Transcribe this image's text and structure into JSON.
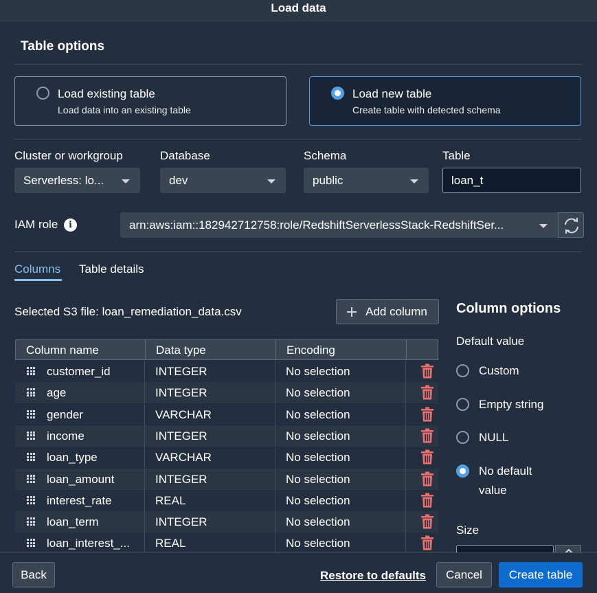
{
  "window": {
    "title": "Load data"
  },
  "table_options": {
    "title": "Table options",
    "existing": {
      "label": "Load existing table",
      "description": "Load data into an existing table",
      "selected": false
    },
    "new": {
      "label": "Load new table",
      "description": "Create table with detected schema",
      "selected": true
    }
  },
  "fields": {
    "cluster": {
      "label": "Cluster or workgroup",
      "value": "Serverless: lo..."
    },
    "database": {
      "label": "Database",
      "value": "dev"
    },
    "schema": {
      "label": "Schema",
      "value": "public"
    },
    "table": {
      "label": "Table",
      "value": "loan_t"
    }
  },
  "iam": {
    "label": "IAM role",
    "value": "arn:aws:iam::182942712758:role/RedshiftServerlessStack-RedshiftSer...",
    "info_icon": "i"
  },
  "tabs": {
    "columns": "Columns",
    "table_details": "Table details",
    "active": "columns"
  },
  "s3": {
    "label": "Selected S3 file: loan_remediation_data.csv"
  },
  "add_column": {
    "label": "Add column"
  },
  "columns_table": {
    "headers": [
      "Column name",
      "Data type",
      "Encoding"
    ],
    "rows": [
      {
        "name": "customer_id",
        "type": "INTEGER",
        "encoding": "No selection"
      },
      {
        "name": "age",
        "type": "INTEGER",
        "encoding": "No selection"
      },
      {
        "name": "gender",
        "type": "VARCHAR",
        "encoding": "No selection"
      },
      {
        "name": "income",
        "type": "INTEGER",
        "encoding": "No selection"
      },
      {
        "name": "loan_type",
        "type": "VARCHAR",
        "encoding": "No selection"
      },
      {
        "name": "loan_amount",
        "type": "INTEGER",
        "encoding": "No selection"
      },
      {
        "name": "interest_rate",
        "type": "REAL",
        "encoding": "No selection"
      },
      {
        "name": "loan_term",
        "type": "INTEGER",
        "encoding": "No selection"
      },
      {
        "name": "loan_interest_...",
        "type": "REAL",
        "encoding": "No selection"
      }
    ]
  },
  "column_options": {
    "title": "Column options",
    "default_value_label": "Default value",
    "options": [
      {
        "label": "Custom",
        "selected": false
      },
      {
        "label": "Empty string",
        "selected": false
      },
      {
        "label": "NULL",
        "selected": false
      },
      {
        "label": "No default value",
        "label_line1": "No default",
        "label_line2": "value",
        "selected": true
      }
    ],
    "size_label": "Size"
  },
  "footer": {
    "back": "Back",
    "restore": "Restore to defaults",
    "cancel": "Cancel",
    "create": "Create table"
  },
  "colors": {
    "background": "#232f3e",
    "accent": "#539fe5",
    "primary_button": "#0f6ccf",
    "danger_icon": "#eb6f6f",
    "active_tab": "#89bdee"
  }
}
